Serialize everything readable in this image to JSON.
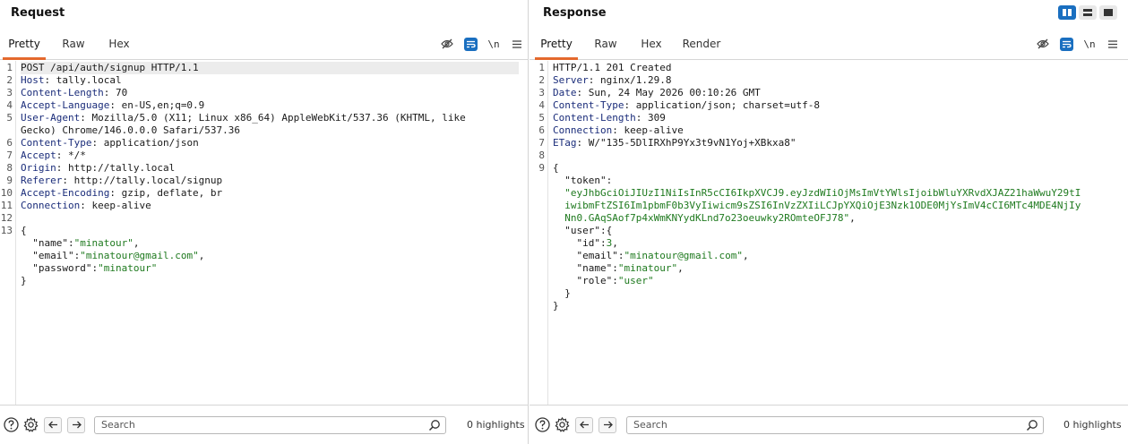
{
  "request": {
    "title": "Request",
    "tabs": [
      "Pretty",
      "Raw",
      "Hex"
    ],
    "newline_label": "\\n",
    "lines": [
      {
        "n": "1",
        "parts": [
          [
            "t",
            "POST /api/auth/signup HTTP/1.1"
          ]
        ],
        "hl": true
      },
      {
        "n": "2",
        "parts": [
          [
            "h",
            "Host"
          ],
          [
            "t",
            ": tally.local"
          ]
        ]
      },
      {
        "n": "3",
        "parts": [
          [
            "h",
            "Content-Length"
          ],
          [
            "t",
            ": 70"
          ]
        ]
      },
      {
        "n": "4",
        "parts": [
          [
            "h",
            "Accept-Language"
          ],
          [
            "t",
            ": en-US,en;q=0.9"
          ]
        ]
      },
      {
        "n": "5",
        "parts": [
          [
            "h",
            "User-Agent"
          ],
          [
            "t",
            ": Mozilla/5.0 (X11; Linux x86_64) AppleWebKit/537.36 (KHTML, like"
          ]
        ]
      },
      {
        "n": "",
        "parts": [
          [
            "t",
            "Gecko) Chrome/146.0.0.0 Safari/537.36"
          ]
        ]
      },
      {
        "n": "6",
        "parts": [
          [
            "h",
            "Content-Type"
          ],
          [
            "t",
            ": application/json"
          ]
        ]
      },
      {
        "n": "7",
        "parts": [
          [
            "h",
            "Accept"
          ],
          [
            "t",
            ": */*"
          ]
        ]
      },
      {
        "n": "8",
        "parts": [
          [
            "h",
            "Origin"
          ],
          [
            "t",
            ": http://tally.local"
          ]
        ]
      },
      {
        "n": "9",
        "parts": [
          [
            "h",
            "Referer"
          ],
          [
            "t",
            ": http://tally.local/signup"
          ]
        ]
      },
      {
        "n": "10",
        "parts": [
          [
            "h",
            "Accept-Encoding"
          ],
          [
            "t",
            ": gzip, deflate, br"
          ]
        ]
      },
      {
        "n": "11",
        "parts": [
          [
            "h",
            "Connection"
          ],
          [
            "t",
            ": keep-alive"
          ]
        ]
      },
      {
        "n": "12",
        "parts": []
      },
      {
        "n": "13",
        "parts": [
          [
            "t",
            "{"
          ]
        ]
      },
      {
        "n": "",
        "parts": [
          [
            "t",
            "  "
          ],
          [
            "k",
            "\"name\""
          ],
          [
            "t",
            ":"
          ],
          [
            "s",
            "\"minatour\""
          ],
          [
            "t",
            ","
          ]
        ]
      },
      {
        "n": "",
        "parts": [
          [
            "t",
            "  "
          ],
          [
            "k",
            "\"email\""
          ],
          [
            "t",
            ":"
          ],
          [
            "s",
            "\"minatour@gmail.com\""
          ],
          [
            "t",
            ","
          ]
        ]
      },
      {
        "n": "",
        "parts": [
          [
            "t",
            "  "
          ],
          [
            "k",
            "\"password\""
          ],
          [
            "t",
            ":"
          ],
          [
            "s",
            "\"minatour\""
          ]
        ]
      },
      {
        "n": "",
        "parts": [
          [
            "t",
            "}"
          ]
        ]
      }
    ],
    "search_placeholder": "Search",
    "highlights": "0 highlights"
  },
  "response": {
    "title": "Response",
    "tabs": [
      "Pretty",
      "Raw",
      "Hex",
      "Render"
    ],
    "newline_label": "\\n",
    "lines": [
      {
        "n": "1",
        "parts": [
          [
            "t",
            "HTTP/1.1 201 Created"
          ]
        ]
      },
      {
        "n": "2",
        "parts": [
          [
            "h",
            "Server"
          ],
          [
            "t",
            ": nginx/1.29.8"
          ]
        ]
      },
      {
        "n": "3",
        "parts": [
          [
            "h",
            "Date"
          ],
          [
            "t",
            ": Sun, 24 May 2026 00:10:26 GMT"
          ]
        ]
      },
      {
        "n": "4",
        "parts": [
          [
            "h",
            "Content-Type"
          ],
          [
            "t",
            ": application/json; charset=utf-8"
          ]
        ]
      },
      {
        "n": "5",
        "parts": [
          [
            "h",
            "Content-Length"
          ],
          [
            "t",
            ": 309"
          ]
        ]
      },
      {
        "n": "6",
        "parts": [
          [
            "h",
            "Connection"
          ],
          [
            "t",
            ": keep-alive"
          ]
        ]
      },
      {
        "n": "7",
        "parts": [
          [
            "h",
            "ETag"
          ],
          [
            "t",
            ": W/\"135-5DlIRXhP9Yx3t9vN1Yoj+XBkxa8\""
          ]
        ]
      },
      {
        "n": "8",
        "parts": []
      },
      {
        "n": "9",
        "parts": [
          [
            "t",
            "{"
          ]
        ]
      },
      {
        "n": "",
        "parts": [
          [
            "t",
            "  "
          ],
          [
            "k",
            "\"token\""
          ],
          [
            "t",
            ":"
          ]
        ]
      },
      {
        "n": "",
        "parts": [
          [
            "s",
            "  \"eyJhbGciOiJIUzI1NiIsInR5cCI6IkpXVCJ9.eyJzdWIiOjMsImVtYWlsIjoibWluYXRvdXJAZ21haWwuY29tI"
          ]
        ]
      },
      {
        "n": "",
        "parts": [
          [
            "s",
            "  iwibmFtZSI6Im1pbmF0b3VyIiwicm9sZSI6InVzZXIiLCJpYXQiOjE3Nzk1ODE0MjYsImV4cCI6MTc4MDE4NjIy"
          ]
        ]
      },
      {
        "n": "",
        "parts": [
          [
            "s",
            "  Nn0.GAqSAof7p4xWmKNYydKLnd7o23oeuwky2ROmteOFJ78\""
          ],
          [
            "t",
            ","
          ]
        ]
      },
      {
        "n": "",
        "parts": [
          [
            "t",
            "  "
          ],
          [
            "k",
            "\"user\""
          ],
          [
            "t",
            ":{"
          ]
        ]
      },
      {
        "n": "",
        "parts": [
          [
            "t",
            "    "
          ],
          [
            "k",
            "\"id\""
          ],
          [
            "t",
            ":"
          ],
          [
            "s",
            "3"
          ],
          [
            "t",
            ","
          ]
        ]
      },
      {
        "n": "",
        "parts": [
          [
            "t",
            "    "
          ],
          [
            "k",
            "\"email\""
          ],
          [
            "t",
            ":"
          ],
          [
            "s",
            "\"minatour@gmail.com\""
          ],
          [
            "t",
            ","
          ]
        ]
      },
      {
        "n": "",
        "parts": [
          [
            "t",
            "    "
          ],
          [
            "k",
            "\"name\""
          ],
          [
            "t",
            ":"
          ],
          [
            "s",
            "\"minatour\""
          ],
          [
            "t",
            ","
          ]
        ]
      },
      {
        "n": "",
        "parts": [
          [
            "t",
            "    "
          ],
          [
            "k",
            "\"role\""
          ],
          [
            "t",
            ":"
          ],
          [
            "s",
            "\"user\""
          ]
        ]
      },
      {
        "n": "",
        "parts": [
          [
            "t",
            "  }"
          ]
        ]
      },
      {
        "n": "",
        "parts": [
          [
            "t",
            "}"
          ]
        ]
      }
    ],
    "search_placeholder": "Search",
    "highlights": "0 highlights"
  },
  "icons": {
    "hide": "eye-slash-icon",
    "wrap": "text-wrap-icon",
    "menu": "hamburger-menu-icon",
    "help": "help-icon",
    "settings": "gear-icon",
    "back": "arrow-left-icon",
    "forward": "arrow-right-icon",
    "search": "search-icon"
  },
  "colors": {
    "accent": "#e4692d",
    "button_blue": "#1a6fc0",
    "header_name": "#1a2c7a",
    "json_string": "#1f7a1f"
  }
}
